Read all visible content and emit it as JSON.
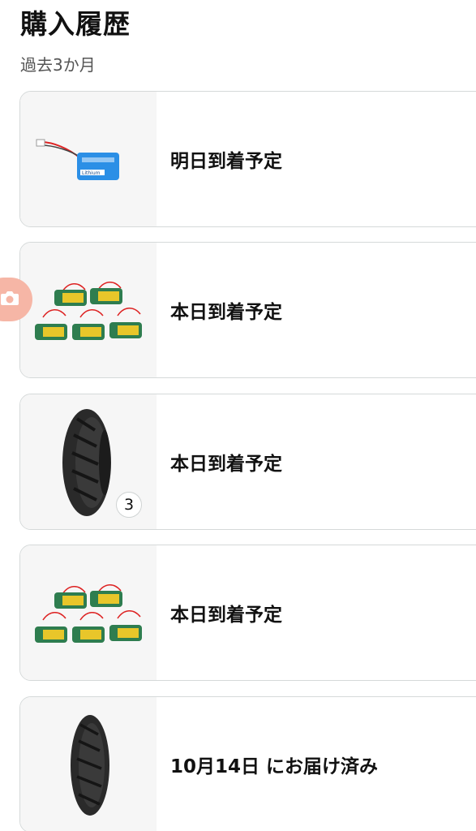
{
  "header": {
    "title": "購入履歴",
    "subtitle": "過去3か月"
  },
  "orders": [
    {
      "status": "明日到着予定",
      "product_icon": "lithium-battery-icon"
    },
    {
      "status": "本日到着予定",
      "product_icon": "battery-pack-icon"
    },
    {
      "status": "本日到着予定",
      "product_icon": "tire-icon",
      "quantity": "3"
    },
    {
      "status": "本日到着予定",
      "product_icon": "battery-pack-icon"
    },
    {
      "status": "10月14日 にお届け済み",
      "product_icon": "tire-icon"
    }
  ],
  "floating_button": {
    "icon": "camera-icon"
  },
  "colors": {
    "card_border": "#d5d9d9",
    "thumb_background": "#f6f6f6",
    "camera_fab": "#f6b6a6",
    "battery_blue": "#2b8fe6",
    "battery_green": "#2e7d4f",
    "battery_yellow": "#e8c62a"
  }
}
